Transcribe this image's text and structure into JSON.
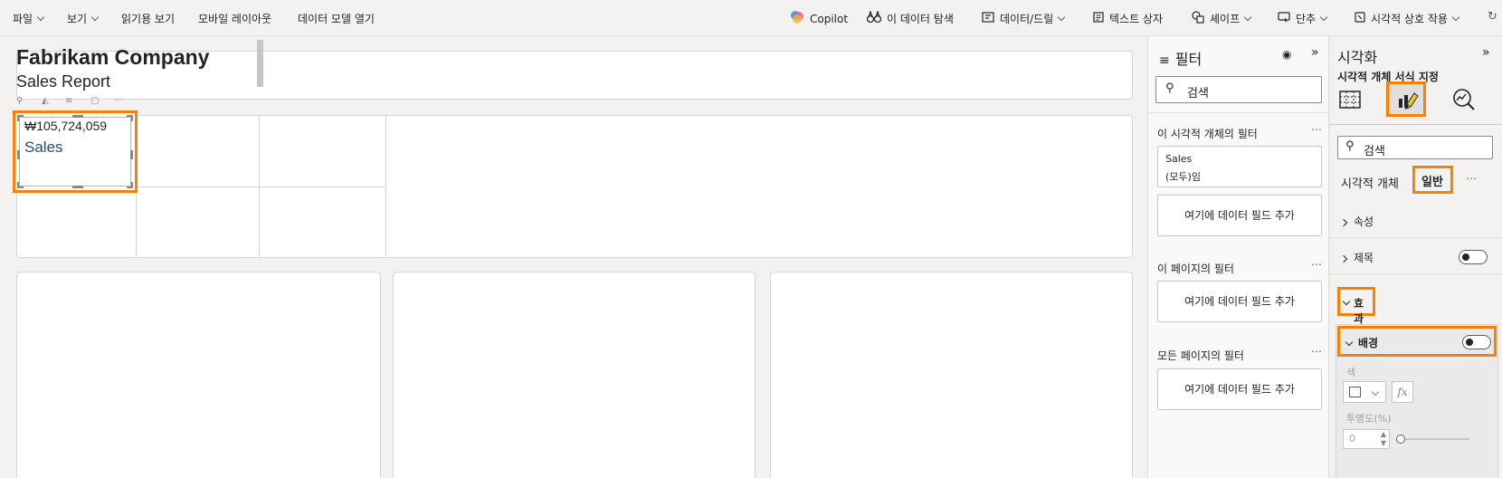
{
  "menu": {
    "file": "파일",
    "view": "보기",
    "reading_view": "읽기용 보기",
    "mobile_layout": "모바일 레이아웃",
    "open_data_model": "데이터 모델 열기",
    "copilot": "Copilot",
    "explore_data": "이 데이터 탐색",
    "data_drill": "데이터/드릴",
    "text_box": "텍스트 상자",
    "shapes": "셰이프",
    "buttons": "단추",
    "visual_interactions": "시각적 상호 작용"
  },
  "report": {
    "company": "Fabrikam Company",
    "subtitle": "Sales Report",
    "kpi_value": "₩105,724,059",
    "kpi_label": "Sales"
  },
  "filters": {
    "title": "필터",
    "search_placeholder": "검색",
    "this_visual": "이 시각적 개체의 필터",
    "this_visual_field": "Sales",
    "this_visual_state": "(모두)임",
    "add_field": "여기에 데이터 필드 추가",
    "this_page": "이 페이지의 필터",
    "all_pages": "모든 페이지의 필터"
  },
  "viz": {
    "title": "시각화",
    "subtitle": "시각적 개체 서식 지정",
    "search_placeholder": "검색",
    "tab_visual": "시각적 개체",
    "tab_general": "일반",
    "properties": "속성",
    "title_section": "제목",
    "effects": "효과",
    "background": "배경",
    "color_label": "색",
    "transparency_label": "투명도(%)",
    "transparency_value": "0",
    "fx": "fx"
  },
  "colors": {
    "highlight": "#ff7f00",
    "accent_yellow": "#f2c811",
    "kpi_label_blue": "#1f4e79"
  }
}
